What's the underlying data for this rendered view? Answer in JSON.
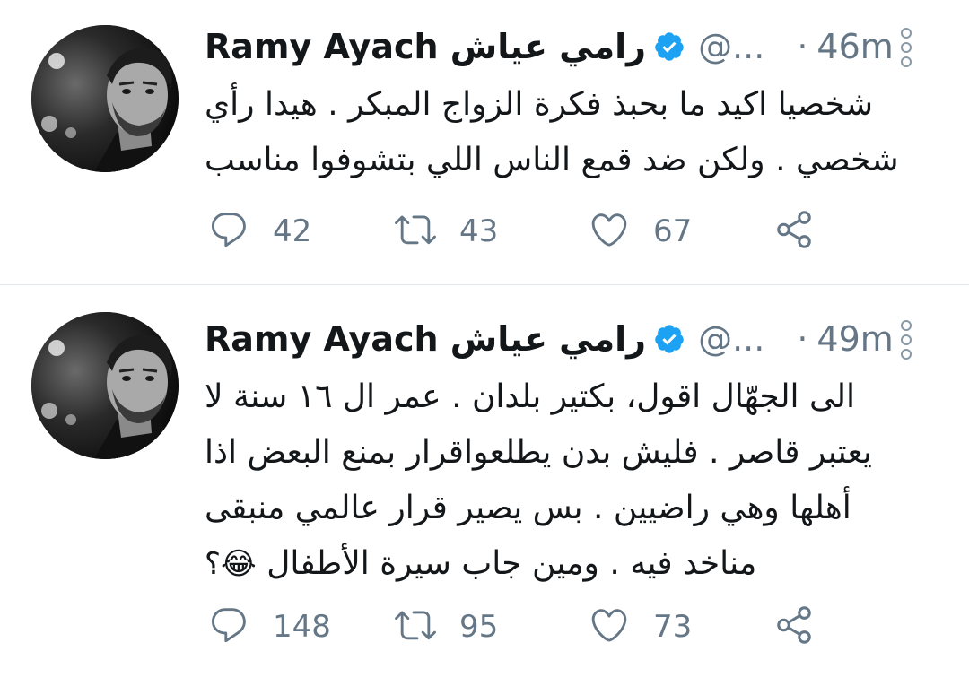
{
  "tweets": [
    {
      "author_name": "Ramy Ayach رامي عياش",
      "handle": "@...",
      "dot": "·",
      "time": "46m",
      "text_lines": [
        "شخصيا اكيد ما بحبذ فكرة الزواج المبكر . هيدا رأي",
        "شخصي . ولكن ضد قمع الناس اللي بتشوفوا مناسب"
      ],
      "replies": "42",
      "retweets": "43",
      "likes": "67"
    },
    {
      "author_name": "Ramy Ayach رامي عياش",
      "handle": "@...",
      "dot": "·",
      "time": "49m",
      "text_lines": [
        "الى الجهّال اقول،   بكتير بلدان . عمر ال ١٦ سنة لا",
        "يعتبر قاصر . فليش بدن يطلعواقرار بمنع البعض اذا",
        "أهلها وهي راضيين . بس يصير قرار عالمي منبقى",
        "مناخد فيه . ومين جاب سيرة الأطفال"
      ],
      "emoji": "😂؟",
      "replies": "148",
      "retweets": "95",
      "likes": "73"
    }
  ],
  "icons": {
    "verified": "verified-badge-icon",
    "more": "more-vertical-icon",
    "reply": "reply-icon",
    "retweet": "retweet-icon",
    "like": "heart-icon",
    "share": "share-icon"
  },
  "colors": {
    "verified": "#1da1f2",
    "muted": "#657786",
    "text": "#14171a",
    "divider": "#e1e8ed"
  }
}
